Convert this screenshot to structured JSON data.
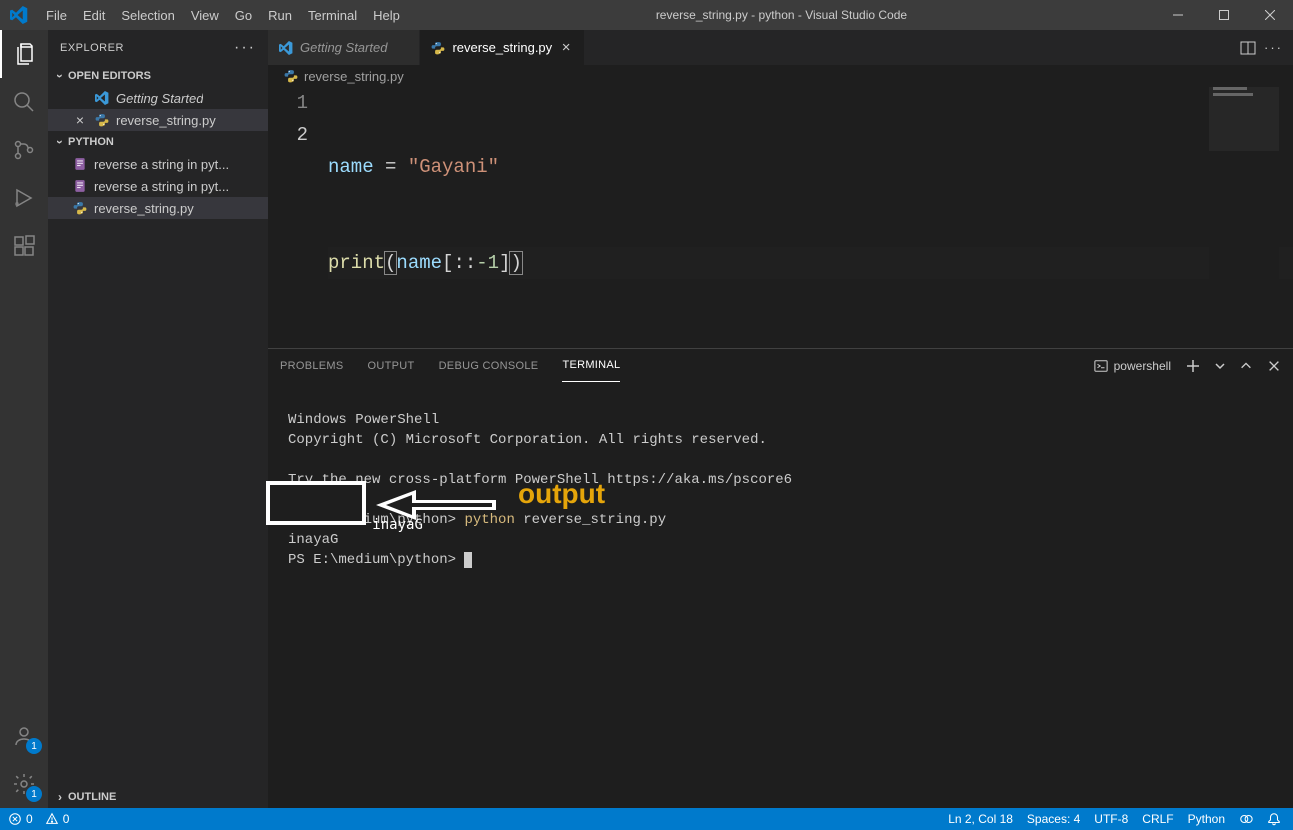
{
  "window": {
    "title": "reverse_string.py - python - Visual Studio Code"
  },
  "menu": [
    "File",
    "Edit",
    "Selection",
    "View",
    "Go",
    "Run",
    "Terminal",
    "Help"
  ],
  "activity_bar": {
    "accounts_badge": "1",
    "settings_badge": "1"
  },
  "sidebar": {
    "title": "EXPLORER",
    "sections": {
      "open_editors": {
        "label": "OPEN EDITORS",
        "items": [
          {
            "label": "Getting Started",
            "icon": "vscode"
          },
          {
            "label": "reverse_string.py",
            "icon": "python",
            "active": true
          }
        ]
      },
      "folder": {
        "label": "PYTHON",
        "items": [
          {
            "label": "reverse a string in pyt..."
          },
          {
            "label": "reverse a string in pyt..."
          },
          {
            "label": "reverse_string.py",
            "active": true
          }
        ]
      },
      "outline": {
        "label": "OUTLINE"
      }
    }
  },
  "tabs": [
    {
      "label": "Getting Started",
      "icon": "vscode"
    },
    {
      "label": "reverse_string.py",
      "icon": "python",
      "active": true
    }
  ],
  "breadcrumb": {
    "file": "reverse_string.py"
  },
  "editor": {
    "lines": {
      "1": {
        "var": "name",
        "assign": " = ",
        "str": "\"Gayani\""
      },
      "2": {
        "fn": "print",
        "open": "(",
        "inner_var": "name",
        "slice": "[::-1]",
        "close": ")"
      }
    }
  },
  "panel": {
    "tabs": [
      "PROBLEMS",
      "OUTPUT",
      "DEBUG CONSOLE",
      "TERMINAL"
    ],
    "active": "TERMINAL",
    "shell_label": "powershell"
  },
  "terminal": {
    "line1": "Windows PowerShell",
    "line2": "Copyright (C) Microsoft Corporation. All rights reserved.",
    "line3": "Try the new cross-platform PowerShell https://aka.ms/pscore6",
    "prompt_path": "PS E:\\medium\\python>",
    "cmd_exec": "python",
    "cmd_arg": "reverse_string.py",
    "output_value": "inayaG",
    "prompt2": "PS E:\\medium\\python>"
  },
  "annotation": {
    "label": "output"
  },
  "status": {
    "errors": "0",
    "warnings": "0",
    "cursor": "Ln 2, Col 18",
    "spaces": "Spaces: 4",
    "encoding": "UTF-8",
    "eol": "CRLF",
    "language": "Python"
  }
}
